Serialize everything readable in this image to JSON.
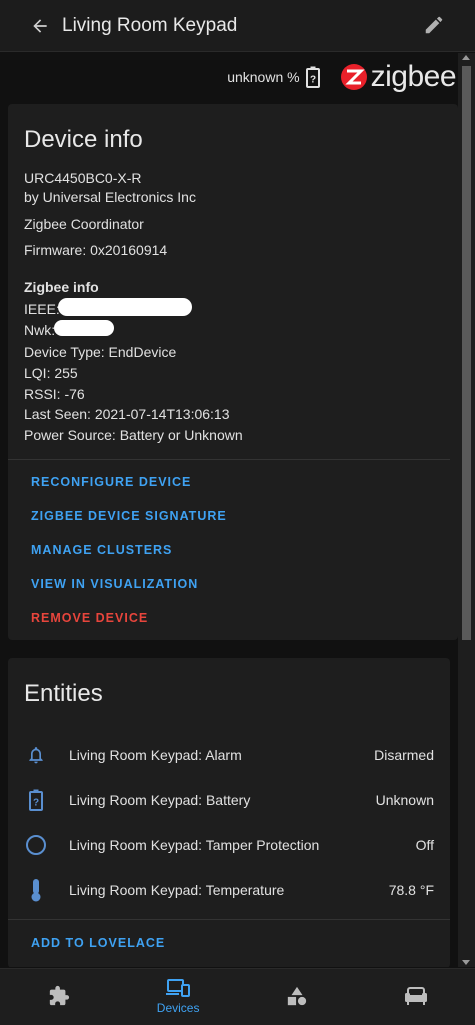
{
  "header": {
    "title": "Living Room Keypad",
    "back_icon": "arrow-left-icon",
    "edit_icon": "pencil-icon"
  },
  "status": {
    "battery_text": "unknown %",
    "brand": "zigbee",
    "brand_color": "#e8202a"
  },
  "device_info": {
    "heading": "Device info",
    "model": "URC4450BC0-X-R",
    "manufacturer": "by Universal Electronics Inc",
    "via": "Zigbee Coordinator",
    "firmware": "Firmware: 0x20160914",
    "zigbee_heading": "Zigbee info",
    "ieee_label": "IEEE:",
    "nwk_label": "Nwk:",
    "device_type": "Device Type: EndDevice",
    "lqi": "LQI: 255",
    "rssi": "RSSI: -76",
    "last_seen": "Last Seen: 2021-07-14T13:06:13",
    "power_source": "Power Source: Battery or Unknown",
    "actions": {
      "reconfigure": "RECONFIGURE DEVICE",
      "signature": "ZIGBEE DEVICE SIGNATURE",
      "clusters": "MANAGE CLUSTERS",
      "visualization": "VIEW IN VISUALIZATION",
      "remove": "REMOVE DEVICE"
    }
  },
  "entities": {
    "heading": "Entities",
    "rows": [
      {
        "name": "Living Room Keypad: Alarm",
        "state": "Disarmed",
        "icon": "bell-icon"
      },
      {
        "name": "Living Room Keypad: Battery",
        "state": "Unknown",
        "icon": "battery-unknown-icon"
      },
      {
        "name": "Living Room Keypad: Tamper Protection",
        "state": "Off",
        "icon": "circle-outline-icon"
      },
      {
        "name": "Living Room Keypad: Temperature",
        "state": "78.8 °F",
        "icon": "thermometer-icon"
      }
    ],
    "add_lovelace": "ADD TO LOVELACE"
  },
  "bottom_nav": {
    "items": [
      {
        "icon": "puzzle-icon",
        "label": ""
      },
      {
        "icon": "devices-icon",
        "label": "Devices"
      },
      {
        "icon": "shapes-icon",
        "label": ""
      },
      {
        "icon": "sofa-icon",
        "label": ""
      }
    ]
  },
  "colors": {
    "accent": "#3fa2f2",
    "danger": "#e8453c",
    "icon_blue": "#5a8fd0"
  }
}
